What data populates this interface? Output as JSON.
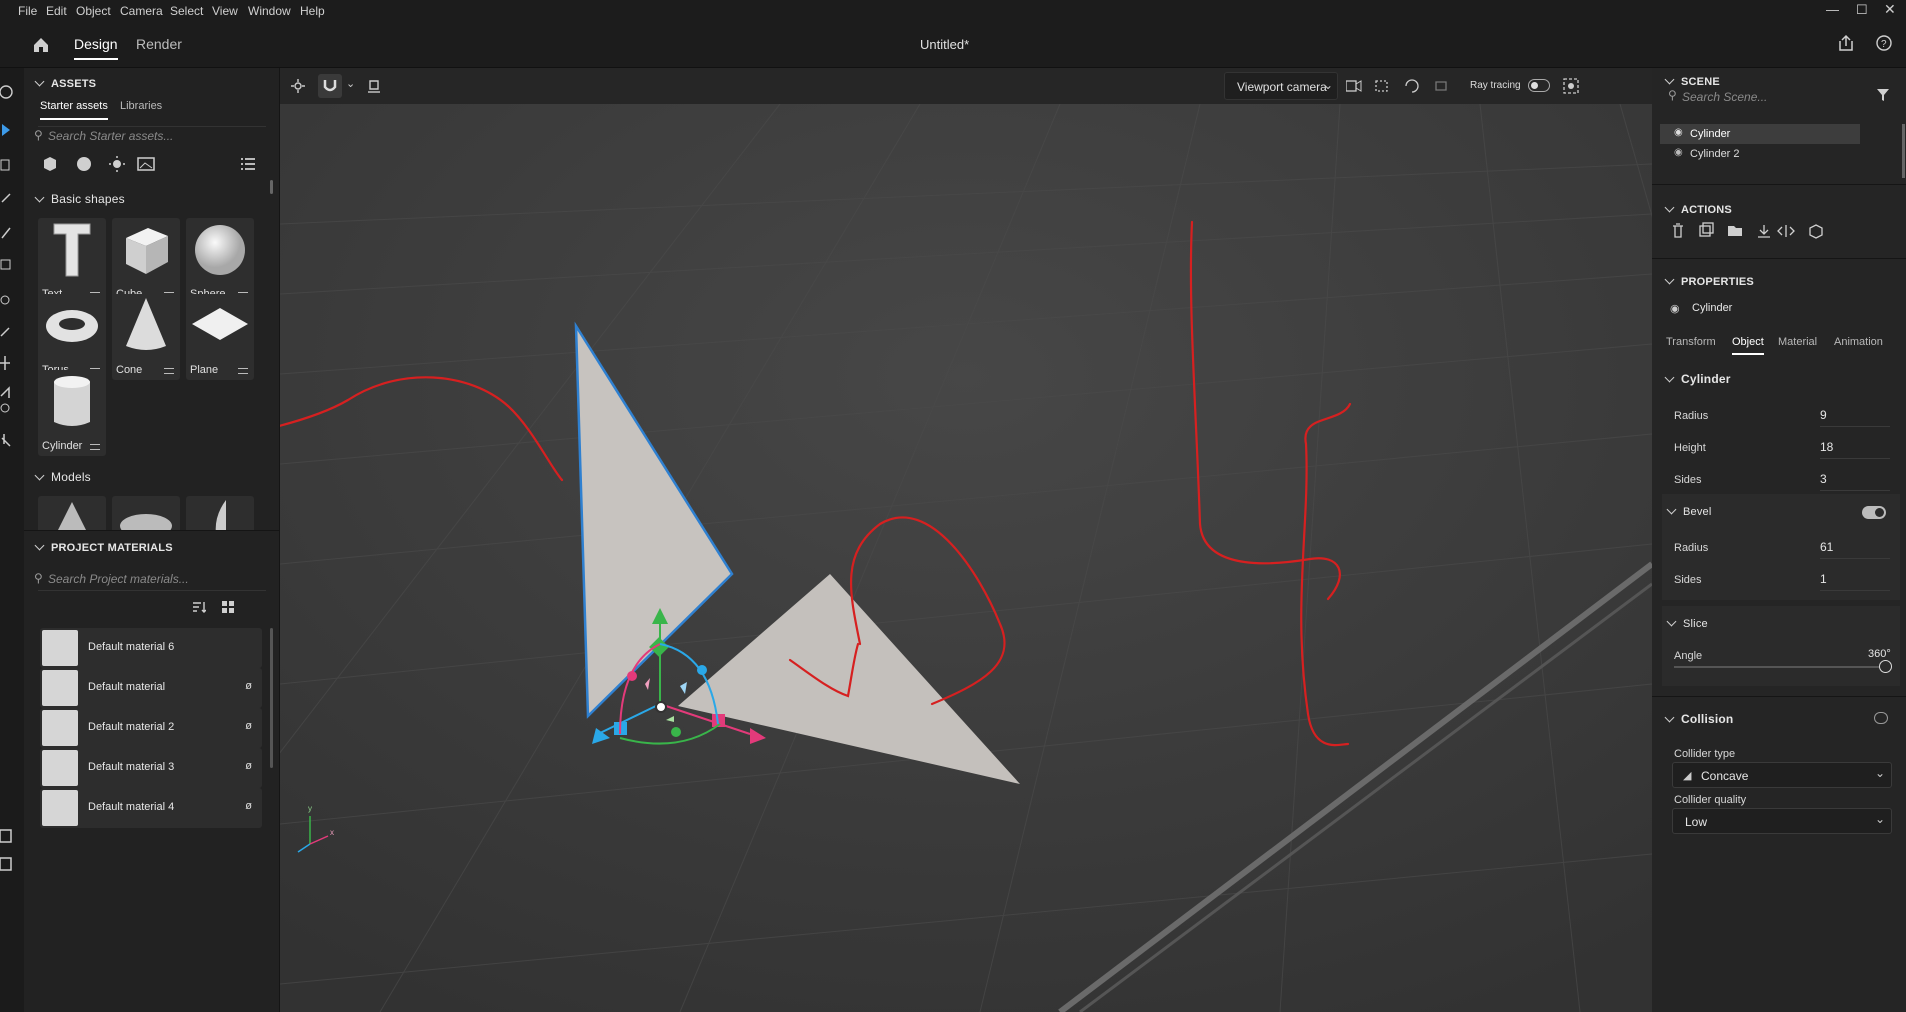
{
  "menubar": {
    "items": [
      "File",
      "Edit",
      "Object",
      "Camera",
      "Select",
      "View",
      "Window",
      "Help"
    ]
  },
  "titlebar": {
    "home_tab": "",
    "tabs": [
      "Design",
      "Render"
    ],
    "doc_title": "Untitled*"
  },
  "assets": {
    "header": "ASSETS",
    "tabs": [
      "Starter assets",
      "Libraries"
    ],
    "search_placeholder": "Search Starter assets...",
    "basic_shapes_header": "Basic shapes",
    "shapes": [
      "Text",
      "Cube",
      "Sphere",
      "Torus",
      "Cone",
      "Plane",
      "Cylinder"
    ],
    "models_header": "Models"
  },
  "project_materials": {
    "header": "PROJECT MATERIALS",
    "search_placeholder": "Search Project materials...",
    "materials": [
      "Default material 6",
      "Default material",
      "Default material 2",
      "Default material 3",
      "Default material 4"
    ]
  },
  "viewport": {
    "camera_select": "Viewport camera",
    "ray_tracing_label": "Ray tracing",
    "ray_tracing_on": false,
    "axis_x": "x",
    "axis_y": "y"
  },
  "scene": {
    "header": "SCENE",
    "search_placeholder": "Search Scene...",
    "items": [
      "Cylinder",
      "Cylinder 2"
    ],
    "selected": "Cylinder"
  },
  "actions": {
    "header": "ACTIONS"
  },
  "properties": {
    "header": "PROPERTIES",
    "object_name": "Cylinder",
    "tabs": [
      "Transform",
      "Object",
      "Material",
      "Animation"
    ],
    "active_tab": "Object",
    "cylinder": {
      "header": "Cylinder",
      "radius_label": "Radius",
      "radius": "9",
      "height_label": "Height",
      "height": "18",
      "sides_label": "Sides",
      "sides": "3"
    },
    "bevel": {
      "header": "Bevel",
      "enabled": true,
      "radius_label": "Radius",
      "radius": "61",
      "sides_label": "Sides",
      "sides": "1"
    },
    "slice": {
      "header": "Slice",
      "angle_label": "Angle",
      "angle": "360°",
      "angle_fraction": 1.0
    },
    "collision": {
      "header": "Collision",
      "enabled": false,
      "collider_type_label": "Collider type",
      "collider_type": "Concave",
      "collider_quality_label": "Collider quality",
      "collider_quality": "Low"
    }
  },
  "colors": {
    "accent": "#4a9fe8",
    "annotation": "#d62020",
    "selection_outline": "#2f80d0"
  }
}
